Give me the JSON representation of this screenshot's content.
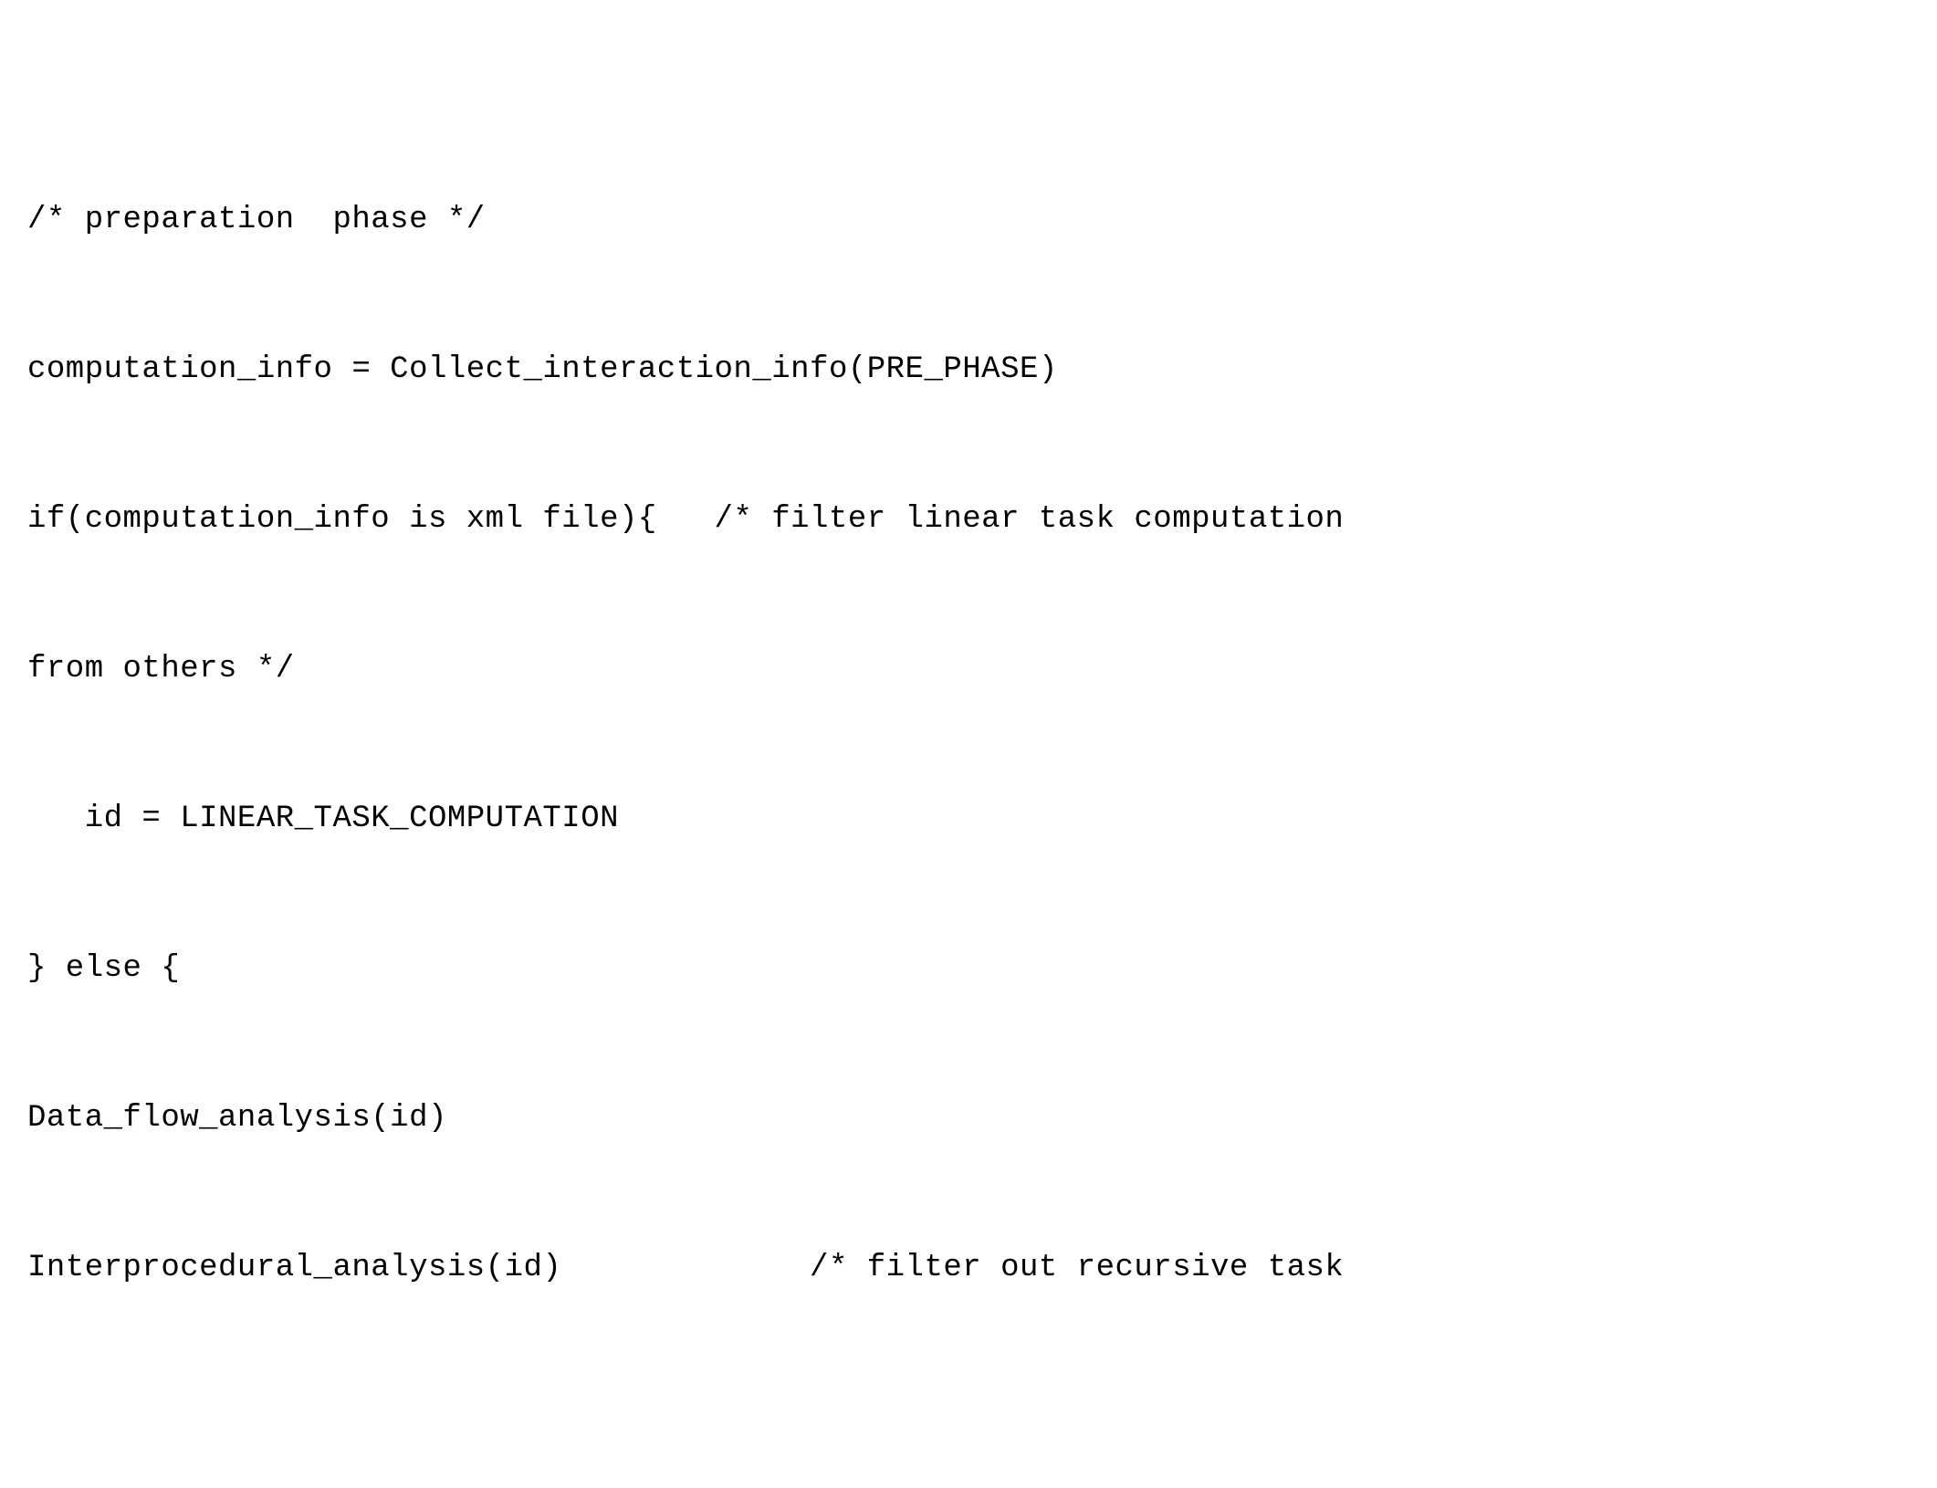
{
  "lines": {
    "l1": "/* preparation  phase */",
    "l2": "computation_info = Collect_interaction_info(PRE_PHASE)",
    "l3": "if(computation_info is xml file){   /* filter linear task computation",
    "l4": "from others */",
    "l5": "   id = LINEAR_TASK_COMPUTATION",
    "l6": "} else {",
    "l7": "Data_flow_analysis(id)",
    "l8": "Interprocedural_analysis(id)             /* filter out recursive task"
  }
}
